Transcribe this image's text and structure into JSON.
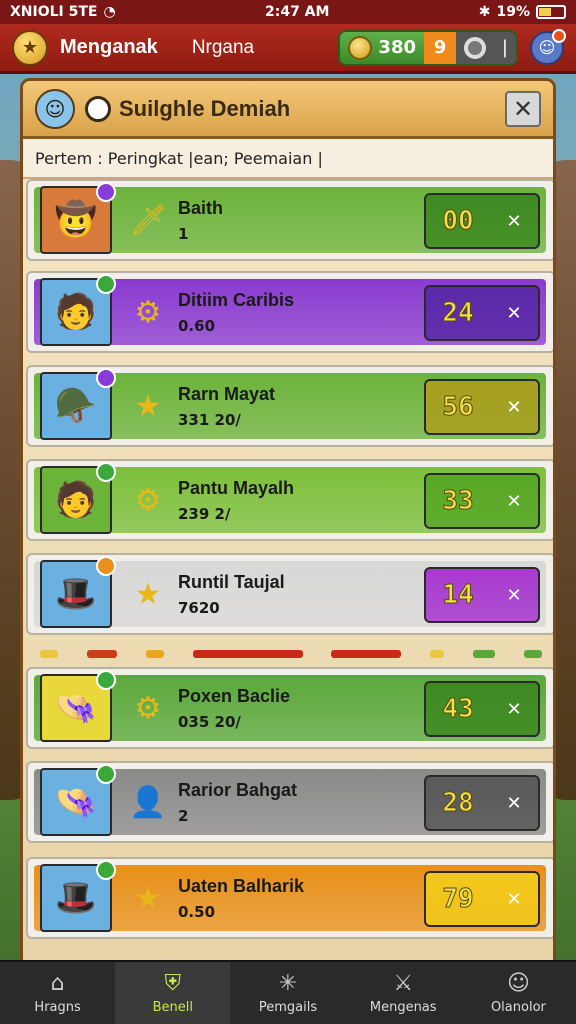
{
  "status_bar": {
    "carrier": "XNIOLI 5TE",
    "time": "2:47 AM",
    "battery": "19%"
  },
  "header": {
    "title": "Menganak",
    "subtitle": "Nrgana",
    "coins": "380",
    "gems": "9"
  },
  "panel": {
    "title": "Suilghle Demiah",
    "filter_text": "Pertem : Peringkat |ean; Peemaian |"
  },
  "rows": [
    {
      "name": "Baith",
      "stat": "1",
      "score": "00",
      "row_color": "#6cb33a",
      "score_color": "#3f8a22",
      "avatar_color": "#d87a3a",
      "badge_color": "#8a3ad8",
      "avatar_icon": "cowboy-hat-icon",
      "item_icon": "golden-sword-icon"
    },
    {
      "name": "Ditiim Caribis",
      "stat": "0.60",
      "score": "24",
      "row_color": "#8a3ad0",
      "score_color": "#5a2aa8",
      "avatar_color": "#6ab0e0",
      "badge_color": "#3aa83a",
      "avatar_icon": "blond-hero-icon",
      "item_icon": "purple-amulet-icon"
    },
    {
      "name": "Rarn Mayat",
      "stat": "331 20/",
      "score": "56",
      "row_color": "#6cb33a",
      "score_color": "#a8a020",
      "avatar_color": "#6ab0e0",
      "badge_color": "#8a3ad8",
      "avatar_icon": "army-hat-icon",
      "item_icon": "star-icon"
    },
    {
      "name": "Pantu Mayalh",
      "stat": "239 2/",
      "score": "33",
      "row_color": "#7cc03a",
      "score_color": "#5aa828",
      "avatar_color": "#6cb33a",
      "badge_color": "#3aa83a",
      "avatar_icon": "brown-hat-icon",
      "item_icon": "gear-icon"
    },
    {
      "name": "Runtil Taujal",
      "stat": "7620",
      "score": "14",
      "row_color": "#d8d8d8",
      "score_color": "#a83ad0",
      "avatar_color": "#6ab0e0",
      "badge_color": "#e8901a",
      "avatar_icon": "purple-hat-icon",
      "item_icon": "star-icon"
    },
    {
      "name": "Poxen Baclie",
      "stat": "035 20/",
      "score": "43",
      "row_color": "#5aa83a",
      "score_color": "#3f8a22",
      "avatar_color": "#e8d83a",
      "badge_color": "#3aa83a",
      "avatar_icon": "tan-hat-icon",
      "item_icon": "gear-icon"
    },
    {
      "name": "Rarior Bahgat",
      "stat": "2",
      "score": "28",
      "row_color": "#8a8a8a",
      "score_color": "#5a5a5a",
      "avatar_color": "#6ab0e0",
      "badge_color": "#3aa83a",
      "avatar_icon": "tan-hat-icon",
      "item_icon": "ranger-icon"
    },
    {
      "name": "Uaten Balharik",
      "stat": "0.50",
      "score": "79",
      "row_color": "#e8901a",
      "score_color": "#f2c81a",
      "avatar_color": "#6ab0e0",
      "badge_color": "#3aa83a",
      "avatar_icon": "purple-hat-icon",
      "item_icon": "blue-star-icon"
    }
  ],
  "bottom_nav": [
    {
      "label": "Hragns",
      "icon": "home-icon"
    },
    {
      "label": "Benell",
      "icon": "shield-icon"
    },
    {
      "label": "Pemgails",
      "icon": "web-icon"
    },
    {
      "label": "Mengenas",
      "icon": "crossed-swords-icon"
    },
    {
      "label": "Olanolor",
      "icon": "profile-icon"
    }
  ]
}
